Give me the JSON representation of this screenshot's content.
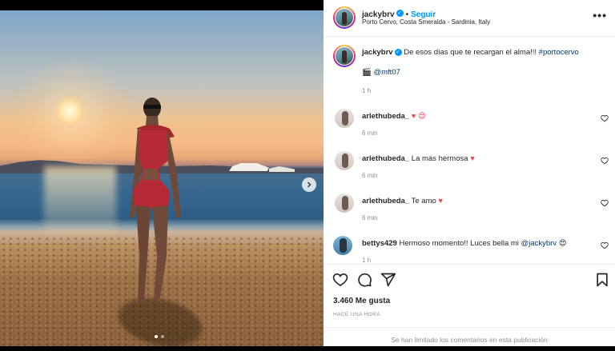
{
  "post": {
    "username": "jackybrv",
    "follow_label": "Seguir",
    "separator": "•",
    "location": "Porto Cervo, Costa Smeralda - Sardinia, Italy",
    "more_label": "•••",
    "photo_alt": "Beach at sunset, woman in red swimsuit",
    "caption_text": "De esos días que te recargan el alma!!! ",
    "caption_hashtag": "#portocervo",
    "caption_mention": "@mft07",
    "caption_time": "1 h",
    "carousel": {
      "total": 2,
      "current": 1
    }
  },
  "comments": [
    {
      "user": "arlethubeda_",
      "text": "",
      "emoji": "♥ 😍",
      "time": "6 min"
    },
    {
      "user": "arlethubeda_",
      "text": "La más hermosa ",
      "emoji": "♥",
      "time": "6 min"
    },
    {
      "user": "arlethubeda_",
      "text": "Te amo ",
      "emoji": "♥",
      "time": "6 min"
    },
    {
      "user": "bettys429",
      "text": "Hermoso momento!! Luces bella mi ",
      "mention": "@jackybrv",
      "emoji": "😍",
      "time": "1 h"
    }
  ],
  "actions": {
    "likes": "3.460 Me gusta",
    "posted": "HACE UNA HORA",
    "comments_limited": "Se han limitado los comentarios en esta publicación"
  },
  "colors": {
    "accent": "#0095f6",
    "heart": "#ed4956",
    "text": "#262626",
    "muted": "#8e8e8e"
  }
}
